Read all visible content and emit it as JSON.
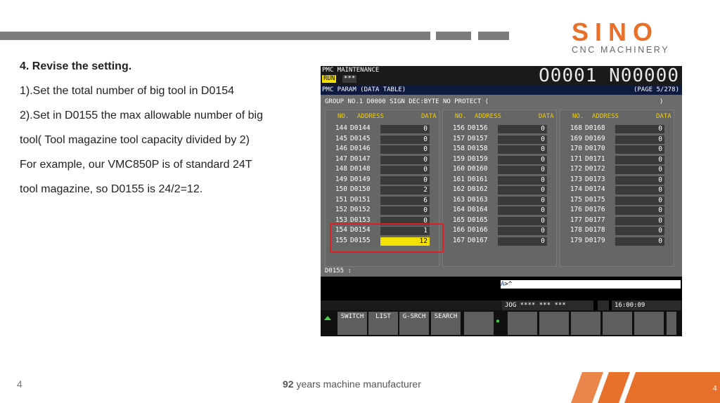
{
  "brand": {
    "name": "SINO",
    "tagline": "CNC MACHINERY",
    "accent": "#e8702a"
  },
  "content": {
    "lines": [
      "4. Revise the setting.",
      "1).Set the total number of big tool in D0154",
      "2).Set in D0155 the max allowable number of big",
      "tool( Tool magazine tool capacity divided by 2)",
      "For example, our VMC850P  is of standard 24T",
      "tool magazine, so D0155 is 24/2=12."
    ]
  },
  "cnc": {
    "title": "PMC MAINTENANCE",
    "run": "RUN",
    "stars": "***",
    "program": "O0001 N00000",
    "subtitle": "PMC PARAM (DATA TABLE)",
    "page": "(PAGE    5/278)",
    "group": "GROUP NO.1    D0000 SIGN DEC:BYTE NO PROTECT (",
    "group_end": ")",
    "headers": {
      "no": "NO.",
      "address": "ADDRESS",
      "data": "DATA"
    },
    "col1": [
      {
        "no": "144",
        "addr": "D0144",
        "data": "0"
      },
      {
        "no": "145",
        "addr": "D0145",
        "data": "0"
      },
      {
        "no": "146",
        "addr": "D0146",
        "data": "0"
      },
      {
        "no": "147",
        "addr": "D0147",
        "data": "0"
      },
      {
        "no": "148",
        "addr": "D0148",
        "data": "0"
      },
      {
        "no": "149",
        "addr": "D0149",
        "data": "0"
      },
      {
        "no": "150",
        "addr": "D0150",
        "data": "2"
      },
      {
        "no": "151",
        "addr": "D0151",
        "data": "6"
      },
      {
        "no": "152",
        "addr": "D0152",
        "data": "0"
      },
      {
        "no": "153",
        "addr": "D0153",
        "data": "0"
      },
      {
        "no": "154",
        "addr": "D0154",
        "data": "1"
      },
      {
        "no": "155",
        "addr": "D0155",
        "data": "12"
      }
    ],
    "col2": [
      {
        "no": "156",
        "addr": "D0156",
        "data": "0"
      },
      {
        "no": "157",
        "addr": "D0157",
        "data": "0"
      },
      {
        "no": "158",
        "addr": "D0158",
        "data": "0"
      },
      {
        "no": "159",
        "addr": "D0159",
        "data": "0"
      },
      {
        "no": "160",
        "addr": "D0160",
        "data": "0"
      },
      {
        "no": "161",
        "addr": "D0161",
        "data": "0"
      },
      {
        "no": "162",
        "addr": "D0162",
        "data": "0"
      },
      {
        "no": "163",
        "addr": "D0163",
        "data": "0"
      },
      {
        "no": "164",
        "addr": "D0164",
        "data": "0"
      },
      {
        "no": "165",
        "addr": "D0165",
        "data": "0"
      },
      {
        "no": "166",
        "addr": "D0166",
        "data": "0"
      },
      {
        "no": "167",
        "addr": "D0167",
        "data": "0"
      }
    ],
    "col3": [
      {
        "no": "168",
        "addr": "D0168",
        "data": "0"
      },
      {
        "no": "169",
        "addr": "D0169",
        "data": "0"
      },
      {
        "no": "170",
        "addr": "D0170",
        "data": "0"
      },
      {
        "no": "171",
        "addr": "D0171",
        "data": "0"
      },
      {
        "no": "172",
        "addr": "D0172",
        "data": "0"
      },
      {
        "no": "173",
        "addr": "D0173",
        "data": "0"
      },
      {
        "no": "174",
        "addr": "D0174",
        "data": "0"
      },
      {
        "no": "175",
        "addr": "D0175",
        "data": "0"
      },
      {
        "no": "176",
        "addr": "D0176",
        "data": "0"
      },
      {
        "no": "177",
        "addr": "D0177",
        "data": "0"
      },
      {
        "no": "178",
        "addr": "D0178",
        "data": "0"
      },
      {
        "no": "179",
        "addr": "D0179",
        "data": "0"
      }
    ],
    "input_prompt": "D0155 :",
    "cmd_prefix": "A",
    "cmd_text": ">^",
    "mode": "JOG **** *** ***",
    "time": "16:00:09",
    "softkeys": [
      "SWITCH",
      "LIST",
      "G-SRCH",
      "SEARCH"
    ]
  },
  "footer": {
    "page_number": "4",
    "bold": "92",
    "text": " years machine manufacturer",
    "corner_number": "4"
  }
}
